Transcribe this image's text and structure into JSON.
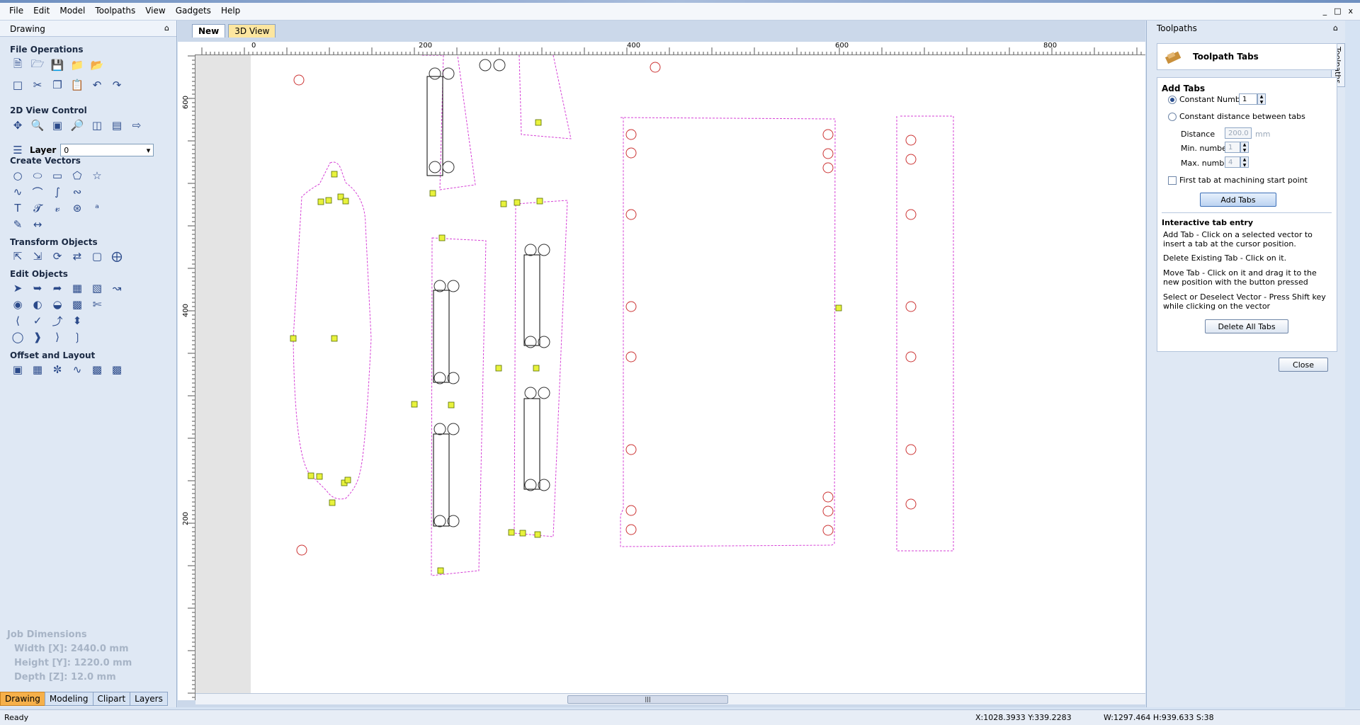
{
  "menu": [
    "File",
    "Edit",
    "Model",
    "Toolpaths",
    "View",
    "Gadgets",
    "Help"
  ],
  "window_controls": [
    "_",
    "□",
    "x"
  ],
  "left_panel": {
    "title": "Drawing",
    "pin": "⌂",
    "sections": {
      "file_operations": "File Operations",
      "view_control": "2D View Control",
      "create_vectors": "Create Vectors",
      "transform_objects": "Transform Objects",
      "edit_objects": "Edit Objects",
      "offset_layout": "Offset and Layout"
    },
    "layer_label": "Layer",
    "layer_value": "0",
    "job_dimensions": {
      "heading": "Job Dimensions",
      "width": "Width  [X]: 2440.0 mm",
      "height": "Height [Y]: 1220.0 mm",
      "depth": "Depth  [Z]: 12.0 mm"
    },
    "tabs": [
      "Drawing",
      "Modeling",
      "Clipart",
      "Layers"
    ]
  },
  "doc_tabs": [
    "New",
    "3D View"
  ],
  "ruler": {
    "top_labels": [
      "0",
      "200",
      "400",
      "600",
      "800"
    ],
    "left_labels": [
      "600",
      "400",
      "200"
    ]
  },
  "right_panel": {
    "title": "Toolpaths",
    "side_tab": "Toolpaths",
    "header": "Toolpath Tabs",
    "add_tabs_heading": "Add Tabs",
    "option_constant_number": "Constant Number",
    "constant_number_value": "1",
    "option_constant_distance": "Constant distance between tabs",
    "distance_label": "Distance",
    "distance_value": "200.0",
    "distance_unit": "mm",
    "min_label": "Min. number",
    "min_value": "1",
    "max_label": "Max. number",
    "max_value": "4",
    "first_tab_label": "First tab at machining start point",
    "add_tabs_button": "Add Tabs",
    "interactive_heading": "Interactive tab entry",
    "help_add_1": "Add Tab - Click on a selected vector to",
    "help_add_2": "insert a tab at the cursor position.",
    "help_delete": "Delete Existing Tab - Click on it.",
    "help_move_1": "Move Tab - Click on it and drag it to the",
    "help_move_2": "new position with the button pressed",
    "help_select_1": "Select or Deselect Vector - Press Shift key",
    "help_select_2": "while clicking on the vector",
    "delete_all_button": "Delete All Tabs",
    "close_button": "Close"
  },
  "status": {
    "left": "Ready",
    "coords": "X:1028.3933 Y:339.2283",
    "dims": "W:1297.464  H:939.633  S:38"
  }
}
